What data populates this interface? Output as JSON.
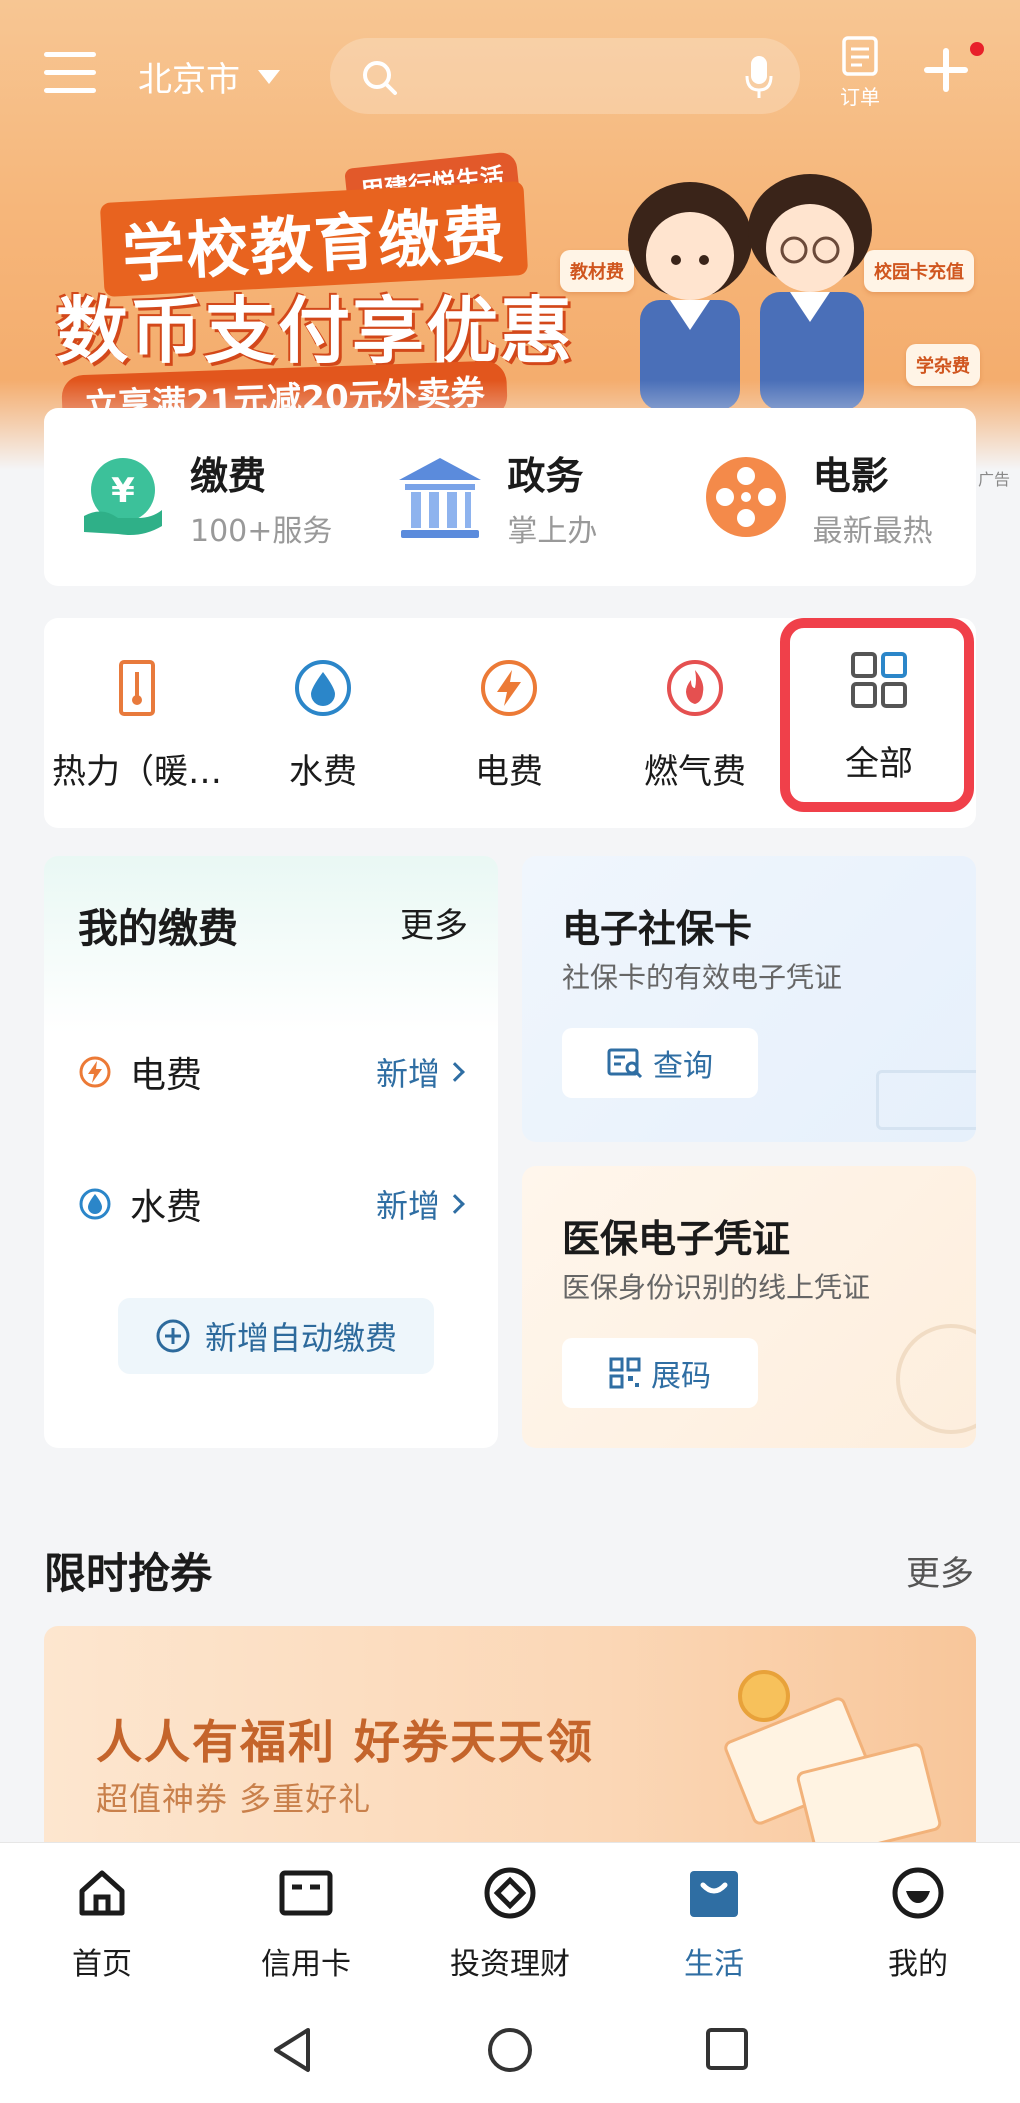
{
  "header": {
    "city": "北京市",
    "order_label": "订单"
  },
  "banner": {
    "tag": "用建行悦生活",
    "line1": "学校教育缴费",
    "line2": "数币支付享优惠",
    "line3": "立享满21元减20元外卖券",
    "chip_textbook": "教材费",
    "chip_campus": "校园卡充值",
    "chip_misc": "学杂费",
    "ad_label": "广告"
  },
  "quick_services": [
    {
      "title": "缴费",
      "subtitle": "100+服务",
      "icon": "payment-icon"
    },
    {
      "title": "政务",
      "subtitle": "掌上办",
      "icon": "government-icon"
    },
    {
      "title": "电影",
      "subtitle": "最新最热",
      "icon": "film-reel-icon"
    }
  ],
  "utilities": [
    {
      "label": "热力（暖…",
      "icon": "thermometer-icon"
    },
    {
      "label": "水费",
      "icon": "water-drop-icon"
    },
    {
      "label": "电费",
      "icon": "lightning-icon"
    },
    {
      "label": "燃气费",
      "icon": "flame-icon"
    },
    {
      "label": "全部",
      "icon": "grid-icon"
    }
  ],
  "my_payments": {
    "title": "我的缴费",
    "more": "更多",
    "items": [
      {
        "name": "电费",
        "action": "新增",
        "icon": "lightning-icon"
      },
      {
        "name": "水费",
        "action": "新增",
        "icon": "water-drop-icon"
      }
    ],
    "auto_pay": "新增自动缴费"
  },
  "social_card": {
    "title": "电子社保卡",
    "subtitle": "社保卡的有效电子凭证",
    "button": "查询"
  },
  "medical_card": {
    "title": "医保电子凭证",
    "subtitle": "医保身份识别的线上凭证",
    "button": "展码"
  },
  "coupons": {
    "title": "限时抢券",
    "more": "更多",
    "banner_line1": "人人有福利 好券天天领",
    "banner_line2": "超值神券 多重好礼"
  },
  "tabbar": {
    "items": [
      {
        "label": "首页",
        "icon": "home-icon"
      },
      {
        "label": "信用卡",
        "icon": "credit-card-icon"
      },
      {
        "label": "投资理财",
        "icon": "investment-icon"
      },
      {
        "label": "生活",
        "icon": "life-icon",
        "active": true
      },
      {
        "label": "我的",
        "icon": "profile-icon"
      }
    ]
  },
  "colors": {
    "accent_blue": "#2f6ea3",
    "highlight_red": "#f0404a",
    "banner_orange": "#f6b67a"
  }
}
